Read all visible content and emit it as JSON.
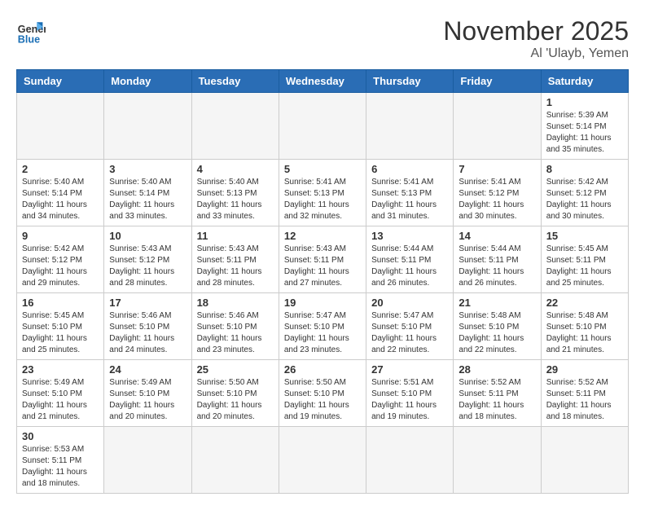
{
  "header": {
    "logo_general": "General",
    "logo_blue": "Blue",
    "month": "November 2025",
    "location": "Al 'Ulayb, Yemen"
  },
  "days_of_week": [
    "Sunday",
    "Monday",
    "Tuesday",
    "Wednesday",
    "Thursday",
    "Friday",
    "Saturday"
  ],
  "weeks": [
    [
      {
        "day": "",
        "info": ""
      },
      {
        "day": "",
        "info": ""
      },
      {
        "day": "",
        "info": ""
      },
      {
        "day": "",
        "info": ""
      },
      {
        "day": "",
        "info": ""
      },
      {
        "day": "",
        "info": ""
      },
      {
        "day": "1",
        "info": "Sunrise: 5:39 AM\nSunset: 5:14 PM\nDaylight: 11 hours and 35 minutes."
      }
    ],
    [
      {
        "day": "2",
        "info": "Sunrise: 5:40 AM\nSunset: 5:14 PM\nDaylight: 11 hours and 34 minutes."
      },
      {
        "day": "3",
        "info": "Sunrise: 5:40 AM\nSunset: 5:14 PM\nDaylight: 11 hours and 33 minutes."
      },
      {
        "day": "4",
        "info": "Sunrise: 5:40 AM\nSunset: 5:13 PM\nDaylight: 11 hours and 33 minutes."
      },
      {
        "day": "5",
        "info": "Sunrise: 5:41 AM\nSunset: 5:13 PM\nDaylight: 11 hours and 32 minutes."
      },
      {
        "day": "6",
        "info": "Sunrise: 5:41 AM\nSunset: 5:13 PM\nDaylight: 11 hours and 31 minutes."
      },
      {
        "day": "7",
        "info": "Sunrise: 5:41 AM\nSunset: 5:12 PM\nDaylight: 11 hours and 30 minutes."
      },
      {
        "day": "8",
        "info": "Sunrise: 5:42 AM\nSunset: 5:12 PM\nDaylight: 11 hours and 30 minutes."
      }
    ],
    [
      {
        "day": "9",
        "info": "Sunrise: 5:42 AM\nSunset: 5:12 PM\nDaylight: 11 hours and 29 minutes."
      },
      {
        "day": "10",
        "info": "Sunrise: 5:43 AM\nSunset: 5:12 PM\nDaylight: 11 hours and 28 minutes."
      },
      {
        "day": "11",
        "info": "Sunrise: 5:43 AM\nSunset: 5:11 PM\nDaylight: 11 hours and 28 minutes."
      },
      {
        "day": "12",
        "info": "Sunrise: 5:43 AM\nSunset: 5:11 PM\nDaylight: 11 hours and 27 minutes."
      },
      {
        "day": "13",
        "info": "Sunrise: 5:44 AM\nSunset: 5:11 PM\nDaylight: 11 hours and 26 minutes."
      },
      {
        "day": "14",
        "info": "Sunrise: 5:44 AM\nSunset: 5:11 PM\nDaylight: 11 hours and 26 minutes."
      },
      {
        "day": "15",
        "info": "Sunrise: 5:45 AM\nSunset: 5:11 PM\nDaylight: 11 hours and 25 minutes."
      }
    ],
    [
      {
        "day": "16",
        "info": "Sunrise: 5:45 AM\nSunset: 5:10 PM\nDaylight: 11 hours and 25 minutes."
      },
      {
        "day": "17",
        "info": "Sunrise: 5:46 AM\nSunset: 5:10 PM\nDaylight: 11 hours and 24 minutes."
      },
      {
        "day": "18",
        "info": "Sunrise: 5:46 AM\nSunset: 5:10 PM\nDaylight: 11 hours and 23 minutes."
      },
      {
        "day": "19",
        "info": "Sunrise: 5:47 AM\nSunset: 5:10 PM\nDaylight: 11 hours and 23 minutes."
      },
      {
        "day": "20",
        "info": "Sunrise: 5:47 AM\nSunset: 5:10 PM\nDaylight: 11 hours and 22 minutes."
      },
      {
        "day": "21",
        "info": "Sunrise: 5:48 AM\nSunset: 5:10 PM\nDaylight: 11 hours and 22 minutes."
      },
      {
        "day": "22",
        "info": "Sunrise: 5:48 AM\nSunset: 5:10 PM\nDaylight: 11 hours and 21 minutes."
      }
    ],
    [
      {
        "day": "23",
        "info": "Sunrise: 5:49 AM\nSunset: 5:10 PM\nDaylight: 11 hours and 21 minutes."
      },
      {
        "day": "24",
        "info": "Sunrise: 5:49 AM\nSunset: 5:10 PM\nDaylight: 11 hours and 20 minutes."
      },
      {
        "day": "25",
        "info": "Sunrise: 5:50 AM\nSunset: 5:10 PM\nDaylight: 11 hours and 20 minutes."
      },
      {
        "day": "26",
        "info": "Sunrise: 5:50 AM\nSunset: 5:10 PM\nDaylight: 11 hours and 19 minutes."
      },
      {
        "day": "27",
        "info": "Sunrise: 5:51 AM\nSunset: 5:10 PM\nDaylight: 11 hours and 19 minutes."
      },
      {
        "day": "28",
        "info": "Sunrise: 5:52 AM\nSunset: 5:11 PM\nDaylight: 11 hours and 18 minutes."
      },
      {
        "day": "29",
        "info": "Sunrise: 5:52 AM\nSunset: 5:11 PM\nDaylight: 11 hours and 18 minutes."
      }
    ],
    [
      {
        "day": "30",
        "info": "Sunrise: 5:53 AM\nSunset: 5:11 PM\nDaylight: 11 hours and 18 minutes."
      },
      {
        "day": "",
        "info": ""
      },
      {
        "day": "",
        "info": ""
      },
      {
        "day": "",
        "info": ""
      },
      {
        "day": "",
        "info": ""
      },
      {
        "day": "",
        "info": ""
      },
      {
        "day": "",
        "info": ""
      }
    ]
  ]
}
